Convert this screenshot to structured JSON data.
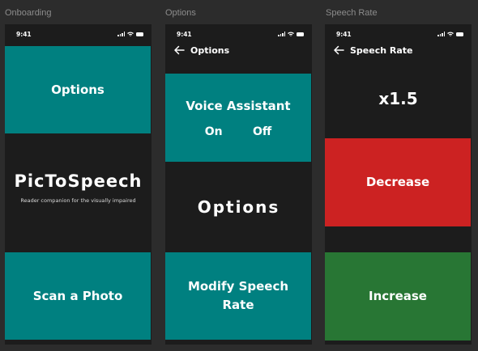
{
  "frames": [
    {
      "label": "Onboarding",
      "time": "9:41",
      "options_button": "Options",
      "app_title": "PicToSpeech",
      "subtitle": "Reader companion for the visually impaired",
      "scan_button": "Scan a Photo"
    },
    {
      "label": "Options",
      "time": "9:41",
      "nav_title": "Options",
      "voice_assistant": {
        "label": "Voice Assistant",
        "on": "On",
        "off": "Off"
      },
      "heading": "Options",
      "modify_button": "Modify Speech Rate"
    },
    {
      "label": "Speech Rate",
      "time": "9:41",
      "nav_title": "Speech Rate",
      "rate_value": "x1.5",
      "decrease_button": "Decrease",
      "increase_button": "Increase"
    }
  ],
  "colors": {
    "teal": "#008080",
    "red": "#cc2222",
    "green": "#287634",
    "screen_bg": "#1c1c1c",
    "canvas_bg": "#2c2c2c"
  },
  "icons": [
    "signal-icon",
    "wifi-icon",
    "battery-icon",
    "back-arrow-icon"
  ]
}
